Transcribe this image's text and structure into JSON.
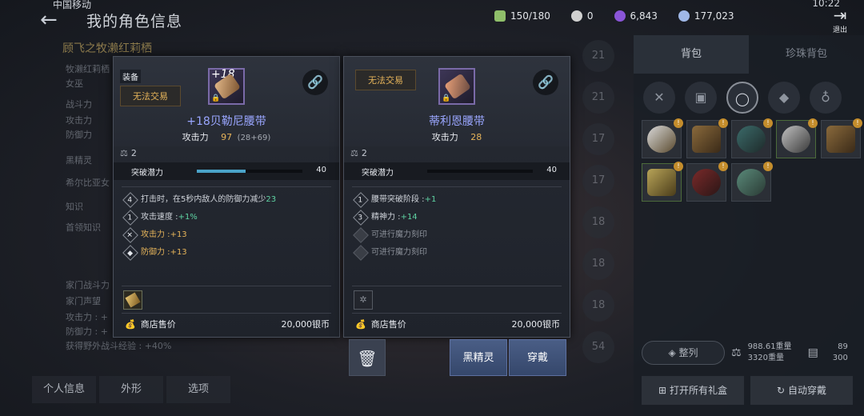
{
  "status_bar": {
    "carrier": "中国移动",
    "time": "10:22"
  },
  "header": {
    "title": "我的角色信息",
    "currencies": [
      {
        "icon": "bag-capacity-icon",
        "value": "150/180",
        "color": "#8fbf6a"
      },
      {
        "icon": "pearl-icon",
        "value": "0",
        "color": "#d0d0d0"
      },
      {
        "icon": "energy-orb-icon",
        "value": "6,843",
        "color": "#8a55d8"
      },
      {
        "icon": "silver-coin-icon",
        "value": "177,023",
        "color": "#9fb7e6"
      }
    ],
    "exit_label": "退出"
  },
  "left_panel": {
    "character_name": "顾飞之牧濑红莉栖",
    "rows": [
      "牧濑红莉栖",
      "女巫",
      "战斗力",
      "攻击力",
      "防御力",
      "黑精灵",
      "希尔比亚女",
      "知识",
      "首领知识",
      "家门战斗力",
      "家门声望",
      "攻击力 : +",
      "防御力 : +",
      "获得野外战斗经验 : +40%"
    ],
    "tabs": [
      "个人信息",
      "外形",
      "选项"
    ]
  },
  "bag_panel": {
    "tabs": [
      "背包",
      "珍珠背包"
    ],
    "sort_label": "整列",
    "weight_current": "988.61重量",
    "weight_max": "3320重量",
    "slots_used": "89",
    "slots_total": "300",
    "open_gifts_label": "打开所有礼盒",
    "auto_equip_label": "自动穿戴"
  },
  "equipped_column": [
    "21",
    "21",
    "17",
    "17",
    "18",
    "18",
    "18",
    "54"
  ],
  "left_card": {
    "equip_badge": "装备",
    "trade_tag": "无法交易",
    "enhance_level": "+18",
    "name": "+18贝勒尼腰带",
    "attack_label": "攻击力",
    "attack_value": "97",
    "attack_detail": "(28+69)",
    "weight": "2",
    "potential_label": "突破潜力",
    "potential_value": "40",
    "potential_fill": 0.46,
    "effects": [
      {
        "mark": "4",
        "text": "打击时，在5秒内敌人的防御力减少",
        "bonus": "23",
        "style": "normal"
      },
      {
        "mark": "1",
        "text": "攻击速度 : ",
        "bonus": "+1%",
        "style": "normal"
      },
      {
        "mark": "✕",
        "text": "攻击力 : ",
        "bonus": "+13",
        "style": "yellow"
      },
      {
        "mark": "◆",
        "text": "防御力 : ",
        "bonus": "+13",
        "style": "yellow"
      }
    ],
    "price_label": "商店售价",
    "price_value": "20,000银币"
  },
  "right_card": {
    "trade_tag": "无法交易",
    "name": "蒂利恩腰带",
    "attack_label": "攻击力",
    "attack_value": "28",
    "weight": "2",
    "potential_label": "突破潜力",
    "potential_value": "40",
    "potential_fill": 0.0,
    "effects": [
      {
        "mark": "1",
        "text": "腰带突破阶段 : ",
        "bonus": "+1",
        "style": "normal"
      },
      {
        "mark": "3",
        "text": "精神力 : ",
        "bonus": "+14",
        "style": "normal"
      },
      {
        "mark": "",
        "text": "可进行魔力刻印",
        "bonus": "",
        "style": "dim"
      },
      {
        "mark": "",
        "text": "可进行魔力刻印",
        "bonus": "",
        "style": "dim"
      }
    ],
    "price_label": "商店售价",
    "price_value": "20,000银币"
  },
  "actions": {
    "black_spirit_label": "黑精灵",
    "equip_label": "穿戴"
  }
}
